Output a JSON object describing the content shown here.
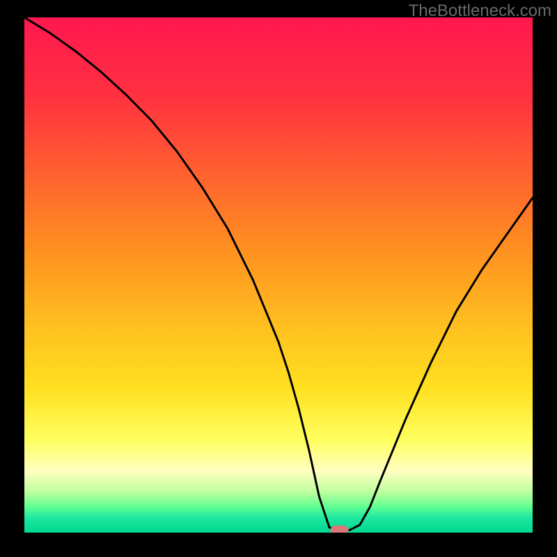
{
  "watermark": "TheBottleneck.com",
  "chart_data": {
    "type": "line",
    "title": "",
    "xlabel": "",
    "ylabel": "",
    "xlim": [
      0,
      100
    ],
    "ylim": [
      0,
      100
    ],
    "gradient_stops": [
      {
        "offset": 0,
        "color": "#ff1850"
      },
      {
        "offset": 15,
        "color": "#ff3040"
      },
      {
        "offset": 30,
        "color": "#ff6030"
      },
      {
        "offset": 45,
        "color": "#ff9020"
      },
      {
        "offset": 60,
        "color": "#ffc020"
      },
      {
        "offset": 72,
        "color": "#ffe020"
      },
      {
        "offset": 82,
        "color": "#ffff60"
      },
      {
        "offset": 88,
        "color": "#ffffc0"
      },
      {
        "offset": 92,
        "color": "#c0ffa0"
      },
      {
        "offset": 95,
        "color": "#60ff90"
      },
      {
        "offset": 97,
        "color": "#20e8a0"
      },
      {
        "offset": 100,
        "color": "#00d890"
      }
    ],
    "series": [
      {
        "name": "bottleneck-curve",
        "x": [
          0,
          5,
          10,
          15,
          20,
          25,
          30,
          35,
          40,
          45,
          50,
          52,
          54,
          56,
          58,
          60,
          62,
          64,
          66,
          68,
          70,
          75,
          80,
          85,
          90,
          95,
          100
        ],
        "values": [
          100,
          97,
          93.5,
          89.5,
          85,
          80,
          74,
          67,
          59,
          49,
          37,
          31,
          24,
          16,
          7,
          1,
          0.5,
          0.5,
          1.5,
          5,
          10,
          22,
          33,
          43,
          51,
          58,
          65
        ]
      }
    ],
    "marker": {
      "name": "bottleneck-marker",
      "x": 62,
      "y": 0.5,
      "color": "#d87878"
    }
  }
}
